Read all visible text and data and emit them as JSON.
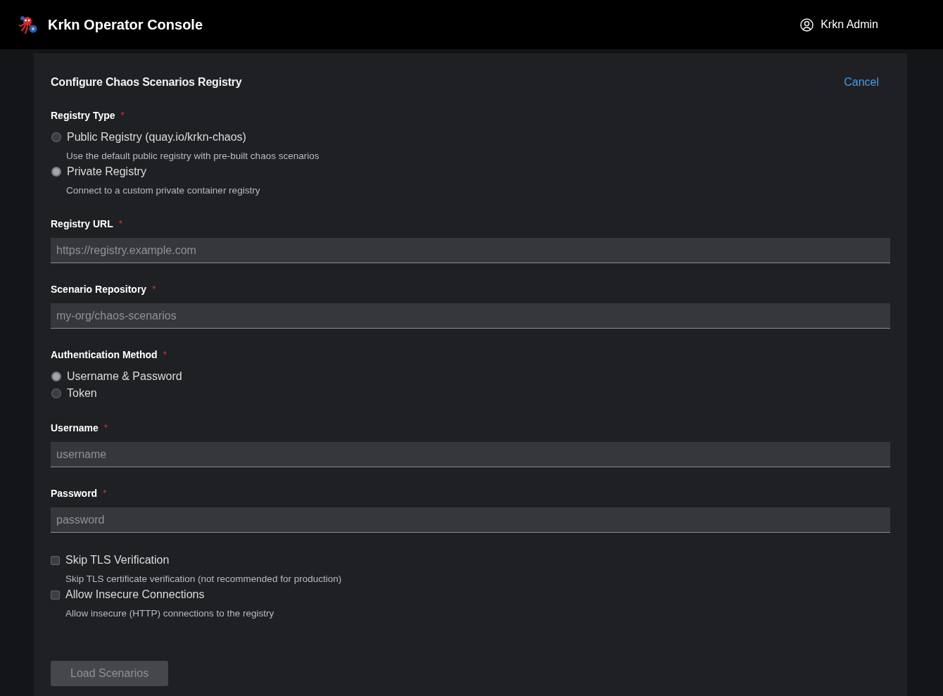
{
  "header": {
    "app_title": "Krkn Operator Console",
    "user": "Krkn Admin"
  },
  "form": {
    "title": "Configure Chaos Scenarios Registry",
    "cancel": "Cancel",
    "fields": [
      {
        "kind": "radio_group",
        "label": "Registry Type",
        "required_mark": "*",
        "options": [
          {
            "label": "Public Registry (quay.io/krkn-chaos)",
            "description": "Use the default public registry with pre-built chaos scenarios",
            "selected": false
          },
          {
            "label": "Private Registry",
            "description": "Connect to a custom private container registry",
            "selected": true
          }
        ]
      },
      {
        "kind": "text",
        "label": "Registry URL",
        "required_mark": "*",
        "placeholder": "https://registry.example.com"
      },
      {
        "kind": "text",
        "label": "Scenario Repository",
        "required_mark": "*",
        "placeholder": "my-org/chaos-scenarios"
      },
      {
        "kind": "radio_group",
        "label": "Authentication Method",
        "required_mark": "*",
        "options": [
          {
            "label": "Username & Password",
            "selected": true
          },
          {
            "label": "Token",
            "selected": false
          }
        ]
      },
      {
        "kind": "text",
        "label": "Username",
        "required_mark": "*",
        "placeholder": "username"
      },
      {
        "kind": "password",
        "label": "Password",
        "required_mark": "*",
        "placeholder": "password"
      },
      {
        "kind": "checkbox_group",
        "options": [
          {
            "label": "Skip TLS Verification",
            "description": "Skip TLS certificate verification (not recommended for production)",
            "checked": false
          },
          {
            "label": "Allow Insecure Connections",
            "description": "Allow insecure (HTTP) connections to the registry",
            "checked": false
          }
        ]
      }
    ],
    "submit": {
      "label": "Load Scenarios",
      "disabled": true
    }
  }
}
